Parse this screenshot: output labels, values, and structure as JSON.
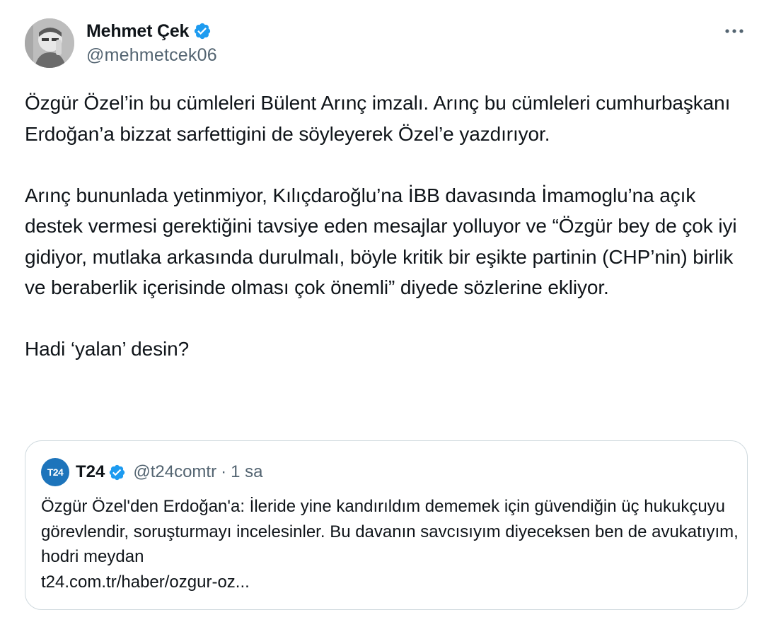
{
  "author": {
    "display_name": "Mehmet Çek",
    "handle": "@mehmetcek06",
    "verified": true
  },
  "tweet": {
    "paragraphs": [
      "Özgür Özel’in bu cümleleri Bülent Arınç imzalı. Arınç bu cümleleri cumhurbaşkanı Erdoğan’a bizzat sarfettigini de söyleyerek Özel’e yazdırıyor.",
      "Arınç bununlada yetinmiyor, Kılıçdaroğlu’na İBB davasında İmamoglu’na açık destek vermesi gerektiğini tavsiye eden mesajlar yolluyor ve “Özgür bey de çok iyi gidiyor, mutlaka arkasında durulmalı, böyle kritik bir eşikte partinin (CHP’nin) birlik ve beraberlik içerisinde olması çok önemli” diyede sözlerine ekliyor.",
      "Hadi ‘yalan’ desin?"
    ]
  },
  "quote": {
    "logo_text": "T24",
    "display_name": "T24",
    "handle": "@t24comtr",
    "separator": "·",
    "time": "1 sa",
    "text": "Özgür Özel'den Erdoğan'a: İleride yine kandırıldım dememek için güvendiğin üç hukukçuyu görevlendir, soruşturmayı incelesinler. Bu davanın savcısıyım diyeceksen ben de avukatıyım, hodri meydan",
    "link": "t24.com.tr/haber/ozgur-oz..."
  },
  "icons": {
    "verified": "verified-badge-icon",
    "more": "more-horizontal-icon"
  },
  "colors": {
    "verified_blue": "#1d9bf0",
    "secondary_text": "#536471",
    "border": "#cfd9de",
    "t24_brand": "#1d74bb"
  }
}
